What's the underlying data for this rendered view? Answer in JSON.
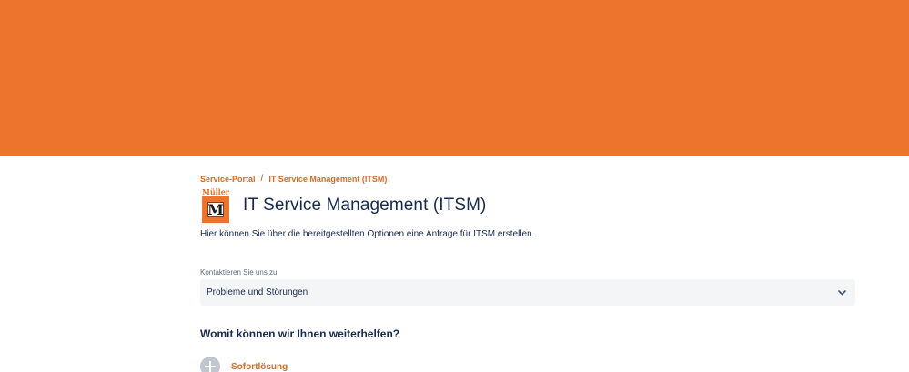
{
  "breadcrumb": {
    "root": "Service-Portal",
    "separator": "/",
    "current": "IT Service Management (ITSM)"
  },
  "logo": {
    "brand_text": "Müller",
    "letter": "M"
  },
  "page": {
    "title": "IT Service Management (ITSM)",
    "description": "Hier können Sie über die bereitgestellten Optionen eine Anfrage für ITSM erstellen."
  },
  "contact": {
    "label": "Kontaktieren Sie uns zu",
    "selected": "Probleme und Störungen",
    "icon": "chevron-down-icon"
  },
  "help": {
    "heading": "Womit können wir Ihnen weiterhelfen?",
    "options": [
      {
        "label": "Sofortlösung",
        "icon": "plus-circle-icon"
      }
    ]
  },
  "colors": {
    "banner": "#ed742c",
    "link": "#d86a24",
    "text": "#172b4d"
  }
}
